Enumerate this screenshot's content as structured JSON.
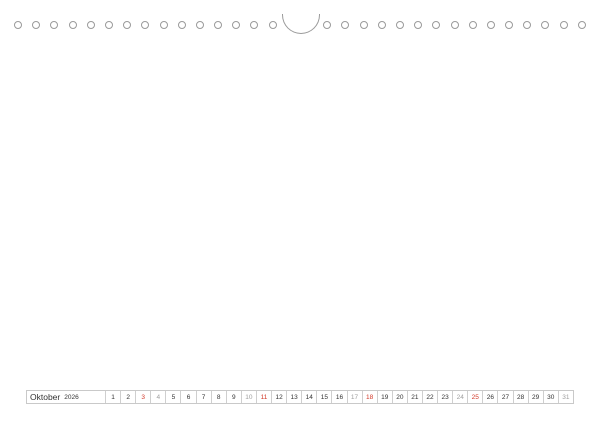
{
  "calendar": {
    "month": "Oktober",
    "year": "2026",
    "days": [
      {
        "n": "1",
        "t": "wd"
      },
      {
        "n": "2",
        "t": "wd"
      },
      {
        "n": "3",
        "t": "hol"
      },
      {
        "n": "4",
        "t": "we"
      },
      {
        "n": "5",
        "t": "wd"
      },
      {
        "n": "6",
        "t": "wd"
      },
      {
        "n": "7",
        "t": "wd"
      },
      {
        "n": "8",
        "t": "wd"
      },
      {
        "n": "9",
        "t": "wd"
      },
      {
        "n": "10",
        "t": "we"
      },
      {
        "n": "11",
        "t": "hol"
      },
      {
        "n": "12",
        "t": "wd"
      },
      {
        "n": "13",
        "t": "wd"
      },
      {
        "n": "14",
        "t": "wd"
      },
      {
        "n": "15",
        "t": "wd"
      },
      {
        "n": "16",
        "t": "wd"
      },
      {
        "n": "17",
        "t": "we"
      },
      {
        "n": "18",
        "t": "hol"
      },
      {
        "n": "19",
        "t": "wd"
      },
      {
        "n": "20",
        "t": "wd"
      },
      {
        "n": "21",
        "t": "wd"
      },
      {
        "n": "22",
        "t": "wd"
      },
      {
        "n": "23",
        "t": "wd"
      },
      {
        "n": "24",
        "t": "we"
      },
      {
        "n": "25",
        "t": "hol"
      },
      {
        "n": "26",
        "t": "wd"
      },
      {
        "n": "27",
        "t": "wd"
      },
      {
        "n": "28",
        "t": "wd"
      },
      {
        "n": "29",
        "t": "wd"
      },
      {
        "n": "30",
        "t": "wd"
      },
      {
        "n": "31",
        "t": "we"
      }
    ]
  },
  "colors": {
    "holiday": "#d23a2a",
    "weekend": "#9e9e9e",
    "weekday": "#333333"
  }
}
